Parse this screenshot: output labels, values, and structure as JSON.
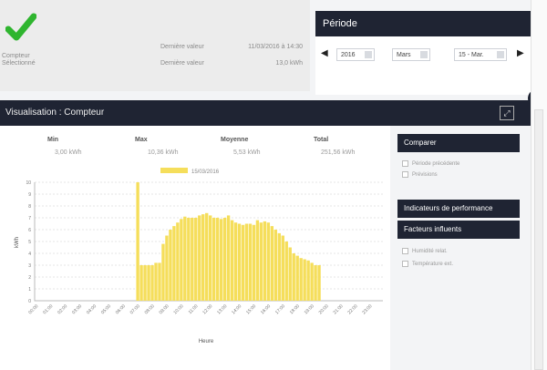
{
  "info": {
    "left_lines": [
      "Compteur",
      "Sélectionné"
    ],
    "mid_labels": [
      "Dernière valeur",
      "Dernière valeur"
    ],
    "right_values": [
      "11/03/2016 à 14:30",
      "13,0 kWh"
    ]
  },
  "period": {
    "title": "Période",
    "year": "2016",
    "month": "Mars",
    "day": "15 - Mar."
  },
  "visualisation_title": "Visualisation : Compteur",
  "stats": {
    "headers": [
      "Min",
      "Max",
      "Moyenne",
      "Total"
    ],
    "values": [
      "3,00 kWh",
      "10,36 kWh",
      "5,53 kWh",
      "251,56 kWh"
    ]
  },
  "right": {
    "compare_label": "Comparer",
    "compare_options": [
      "Période précédente",
      "Prévisions"
    ],
    "kpi_label": "Indicateurs de performance",
    "factors_label": "Facteurs influents",
    "factor_options": [
      "Humidité relat.",
      "Température ext."
    ]
  },
  "colors": {
    "accent_dark": "#1f2433",
    "bar": "#f5de5b",
    "check": "#2fb52f"
  },
  "icons": [
    "check-icon",
    "prev-arrow-icon",
    "next-arrow-icon",
    "expand-icon",
    "menu-icon"
  ],
  "chart_data": {
    "type": "bar",
    "legend": [
      "15/03/2016"
    ],
    "xlabel": "Heure",
    "ylabel": "kWh",
    "ylim": [
      0,
      10
    ],
    "y_ticks": [
      0,
      1,
      2,
      3,
      4,
      5,
      6,
      7,
      8,
      9,
      10
    ],
    "x_tick_labels": [
      "00:00",
      "01:00",
      "02:00",
      "03:00",
      "04:00",
      "05:00",
      "06:00",
      "07:00",
      "08:00",
      "09:00",
      "10:00",
      "11:00",
      "12:00",
      "13:00",
      "14:00",
      "15:00",
      "16:00",
      "17:00",
      "18:00",
      "19:00",
      "20:00",
      "21:00",
      "22:00",
      "23:00"
    ],
    "values": [
      0,
      0,
      0,
      0,
      0,
      0,
      0,
      0,
      0,
      0,
      0,
      0,
      0,
      0,
      0,
      0,
      0,
      0,
      0,
      0,
      0,
      0,
      0,
      0,
      0,
      0,
      0,
      0,
      10,
      3,
      3,
      3,
      3,
      3.2,
      3.2,
      4.8,
      5.5,
      6.0,
      6.3,
      6.6,
      6.9,
      7.1,
      7.0,
      7.0,
      7.0,
      7.2,
      7.3,
      7.4,
      7.2,
      7.0,
      7.0,
      6.9,
      7.0,
      7.2,
      6.8,
      6.6,
      6.5,
      6.4,
      6.5,
      6.5,
      6.4,
      6.8,
      6.6,
      6.7,
      6.6,
      6.3,
      6.0,
      5.7,
      5.5,
      5.0,
      4.5,
      4.0,
      3.8,
      3.6,
      3.5,
      3.4,
      3.2,
      3.0,
      3.0,
      0,
      0,
      0,
      0,
      0,
      0,
      0,
      0,
      0,
      0,
      0,
      0,
      0,
      0,
      0,
      0,
      0
    ]
  }
}
